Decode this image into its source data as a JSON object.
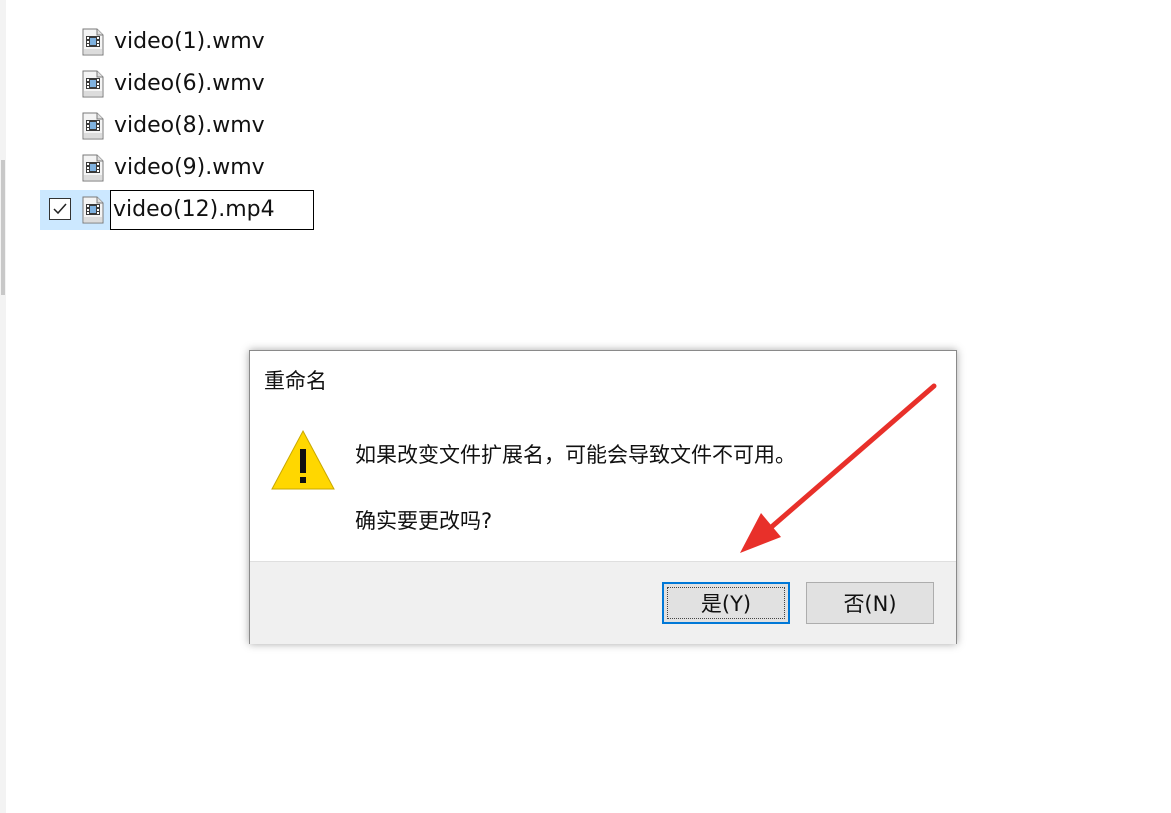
{
  "files": [
    {
      "name": "video(1).wmv",
      "icon": "wmv-file-icon"
    },
    {
      "name": "video(6).wmv",
      "icon": "wmv-file-icon"
    },
    {
      "name": "video(8).wmv",
      "icon": "wmv-file-icon"
    },
    {
      "name": "video(9).wmv",
      "icon": "wmv-file-icon"
    }
  ],
  "selected_file": {
    "rename_value": "video(12).mp4",
    "icon": "wmv-file-icon",
    "checked": true
  },
  "dialog": {
    "title": "重命名",
    "message": "如果改变文件扩展名，可能会导致文件不可用。",
    "question": "确实要更改吗?",
    "yes_label": "是(Y)",
    "no_label": "否(N)",
    "icon": "warning-icon"
  },
  "annotation": {
    "color": "#e8302a",
    "icon": "red-arrow-annotation"
  },
  "colors": {
    "selection": "#cce8ff",
    "default_button_border": "#0078d7",
    "warning_yellow": "#ffd700"
  }
}
